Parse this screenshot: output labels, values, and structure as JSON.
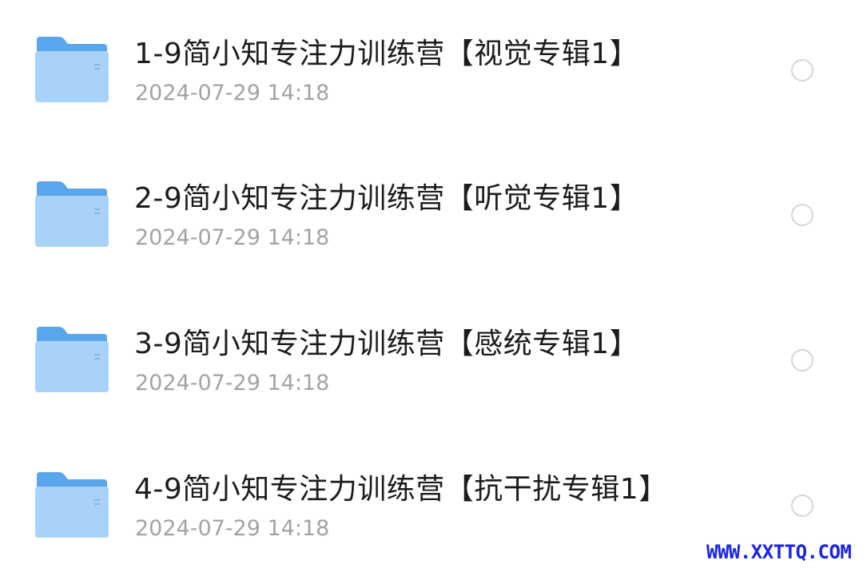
{
  "items": [
    {
      "title": "1-9简小知专注力训练营【视觉专辑1】",
      "date": "2024-07-29 14:18"
    },
    {
      "title": "2-9简小知专注力训练营【听觉专辑1】",
      "date": "2024-07-29 14:18"
    },
    {
      "title": "3-9简小知专注力训练营【感统专辑1】",
      "date": "2024-07-29 14:18"
    },
    {
      "title": "4-9简小知专注力训练营【抗干扰专辑1】",
      "date": "2024-07-29 14:18"
    }
  ],
  "icons": {
    "folder": "folder-icon",
    "select": "radio-unchecked"
  },
  "colors": {
    "folder_back": "#5aa6ec",
    "folder_front": "#a8d2f7",
    "title": "#1c1c1c",
    "date": "#a3a3a3",
    "watermark": "#1a24e8"
  },
  "watermark": "WWW.XXTTQ.COM"
}
